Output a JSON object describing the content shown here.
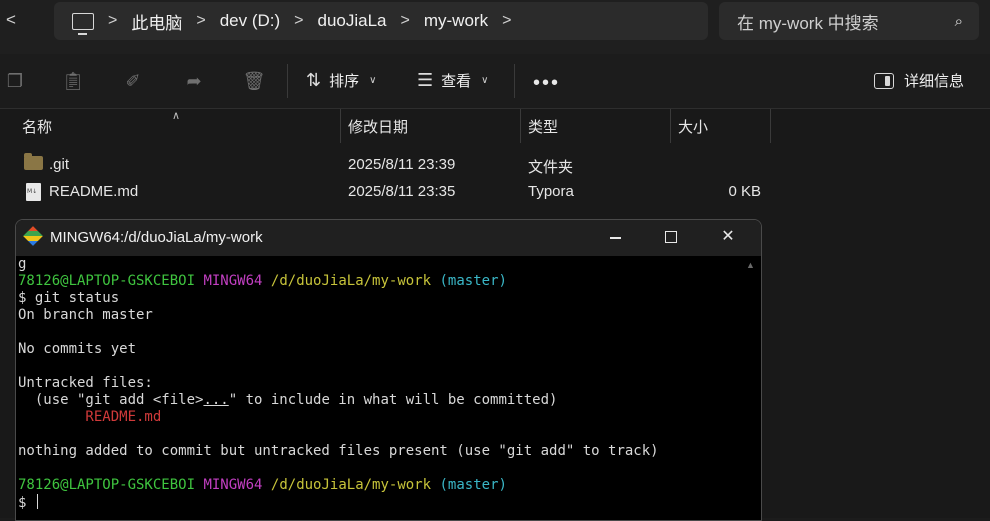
{
  "address": {
    "crumbs": [
      "此电脑",
      "dev (D:)",
      "duoJiaLa",
      "my-work"
    ],
    "sep": ">"
  },
  "search": {
    "placeholder": "在 my-work 中搜索"
  },
  "toolbar": {
    "sort_label": "排序",
    "view_label": "查看",
    "more_label": "•••",
    "details_label": "详细信息"
  },
  "columns": {
    "name": "名称",
    "modified": "修改日期",
    "type": "类型",
    "size": "大小"
  },
  "files": [
    {
      "name": ".git",
      "modified": "2025/8/11 23:39",
      "type": "文件夹",
      "size": ""
    },
    {
      "name": "README.md",
      "modified": "2025/8/11 23:35",
      "type": "Typora",
      "size": "0 KB"
    }
  ],
  "terminal": {
    "title": "MINGW64:/d/duoJiaLa/my-work",
    "line_g": "g",
    "prompt_user": "78126@LAPTOP-GSKCEBOI",
    "prompt_sys": "MINGW64",
    "prompt_path": "/d/duoJiaLa/my-work",
    "prompt_branch": "(master)",
    "cmd": "$ git status",
    "branch_line": "On branch master",
    "no_commits": "No commits yet",
    "untracked_header": "Untracked files:",
    "hint_a": "  (use \"git add <file>",
    "hint_b": "...",
    "hint_c": "\" to include in what will be committed)",
    "untracked_file": "        README.md",
    "nothing_added": "nothing added to commit but untracked files present (use \"git add\" to track)",
    "final_prompt": "$ "
  }
}
